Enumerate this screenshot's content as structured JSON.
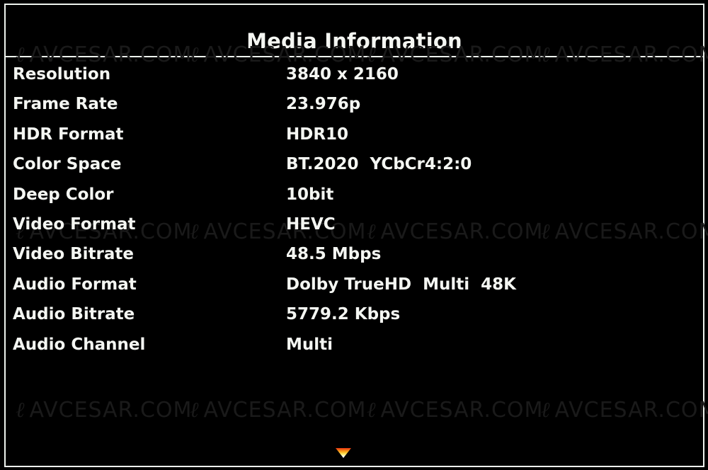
{
  "dialog": {
    "title": "Media Information",
    "watermark_text": "AVCESAR.COM",
    "rows": [
      {
        "label": "Resolution",
        "value": "3840 x 2160"
      },
      {
        "label": "Frame Rate",
        "value": "23.976p"
      },
      {
        "label": "HDR Format",
        "value": "HDR10"
      },
      {
        "label": "Color Space",
        "value": "BT.2020  YCbCr4:2:0"
      },
      {
        "label": "Deep Color",
        "value": "10bit"
      },
      {
        "label": "Video Format",
        "value": "HEVC"
      },
      {
        "label": "Video Bitrate",
        "value": "48.5 Mbps"
      },
      {
        "label": "Audio Format",
        "value": "Dolby TrueHD  Multi  48K"
      },
      {
        "label": "Audio Bitrate",
        "value": "5779.2 Kbps"
      },
      {
        "label": "Audio Channel",
        "value": "Multi"
      }
    ],
    "scroll_indicator": "scroll-down-arrow-icon",
    "colors": {
      "background": "#000000",
      "text": "#f4f6f2",
      "border": "#eef3ee",
      "arrow_top": "#e83410",
      "arrow_mid": "#f9a51a",
      "arrow_bottom": "#ffffff"
    }
  }
}
